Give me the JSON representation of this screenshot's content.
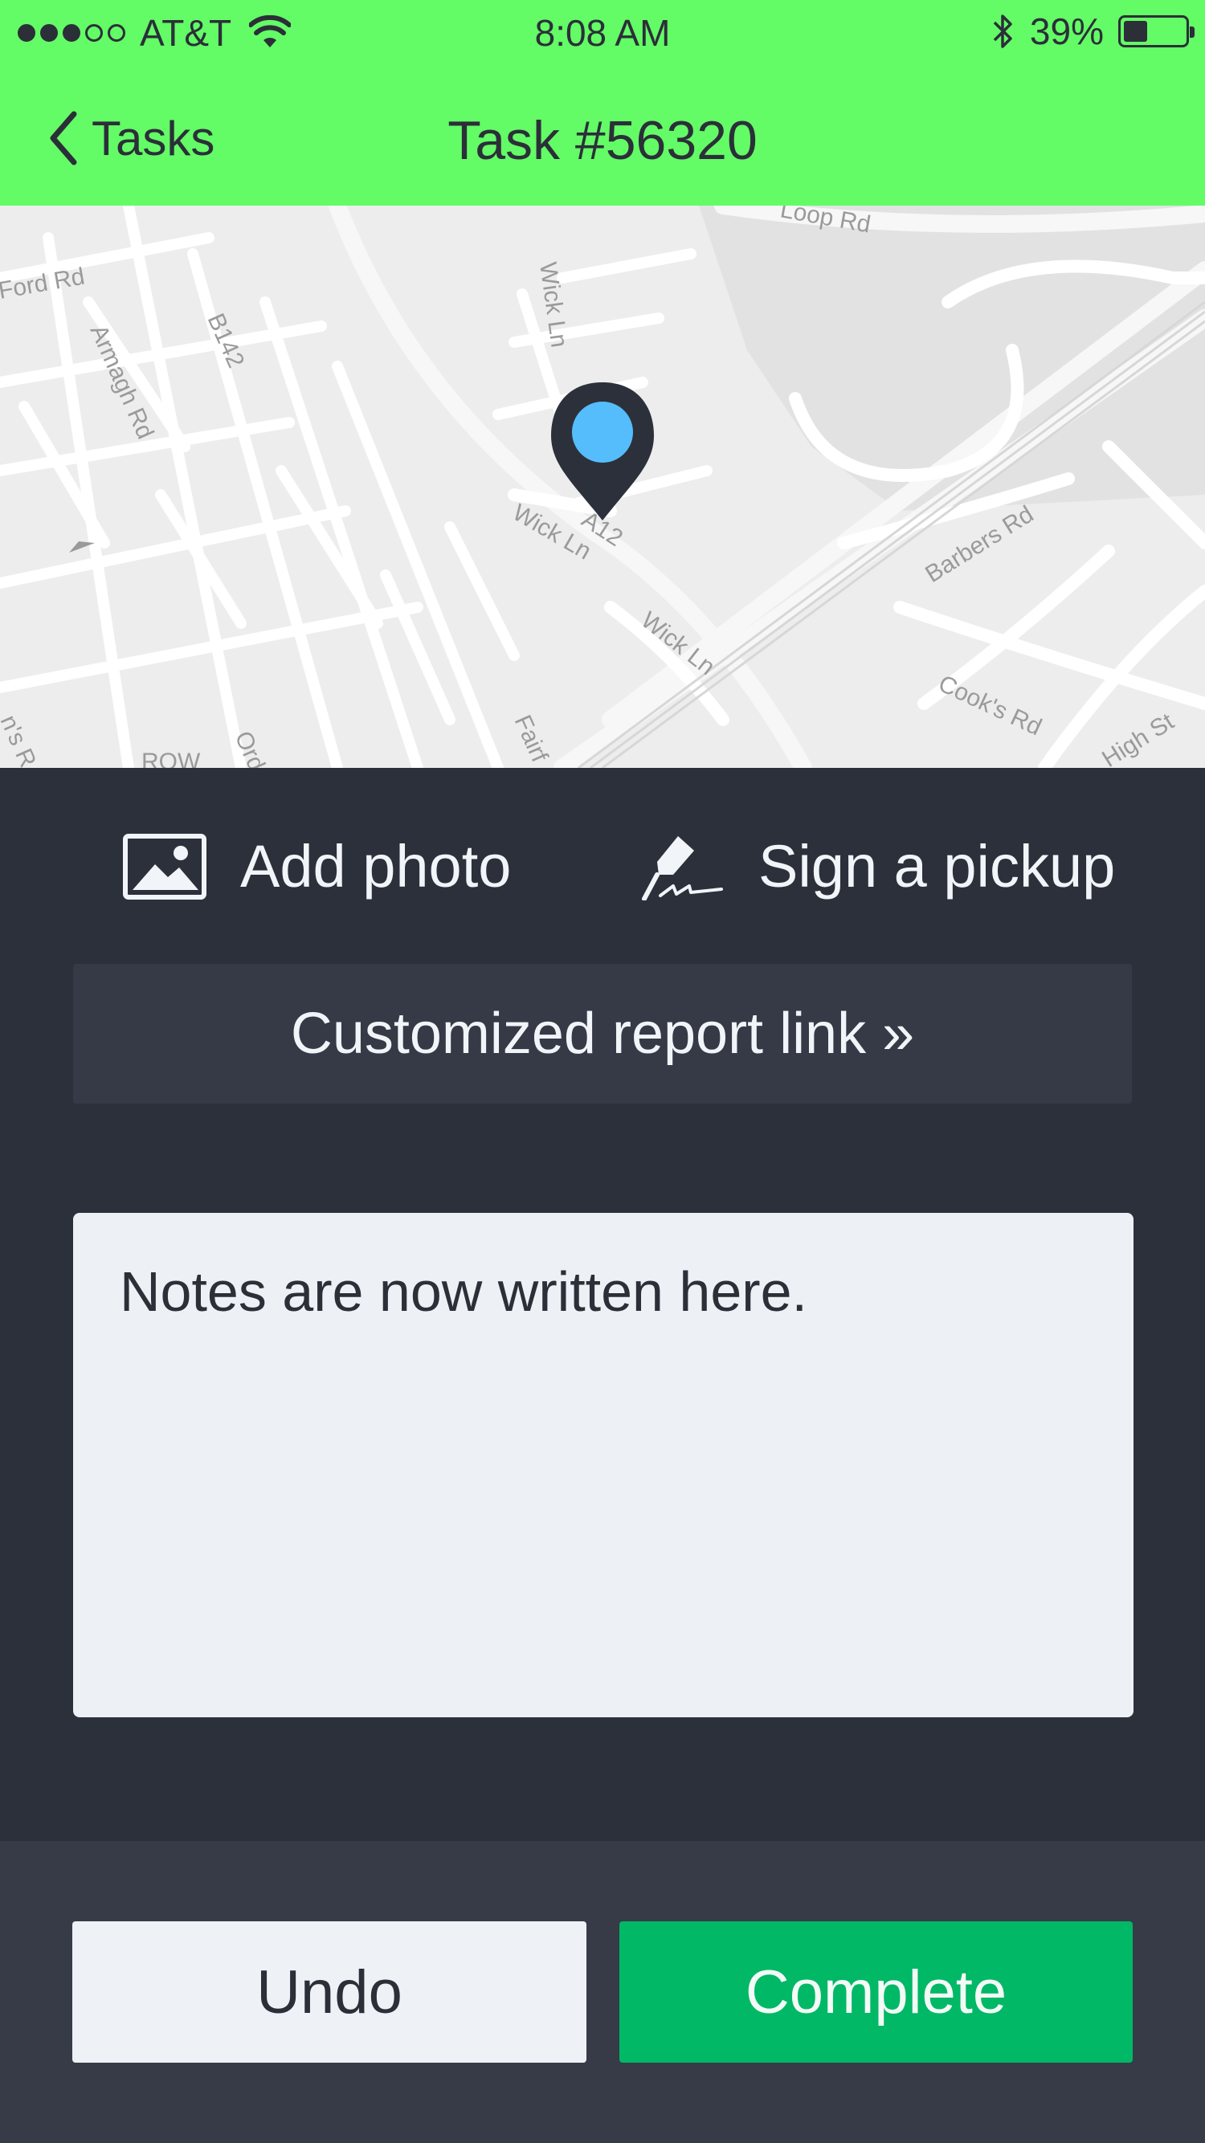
{
  "status_bar": {
    "carrier": "AT&T",
    "time": "8:08 AM",
    "battery_percent": "39%",
    "battery_level": 0.39,
    "signal_filled": 3,
    "signal_total": 5
  },
  "nav": {
    "back_label": "Tasks",
    "title": "Task #56320"
  },
  "map": {
    "labels": [
      "Ford Rd",
      "Armagh Rd",
      "B142",
      "Wick Ln",
      "Loop Rd",
      "A12",
      "Wick Ln",
      "Wick Ln",
      "Barbers Rd",
      "Cook's Rd",
      "High St",
      "Fairf",
      "Ord",
      "ROW",
      "n's R"
    ],
    "marker_icon": "map-pin-icon",
    "marker_color": "#55bdfb"
  },
  "actions": {
    "add_photo": "Add photo",
    "add_photo_icon": "image-icon",
    "sign_pickup": "Sign a pickup",
    "sign_pickup_icon": "pen-icon"
  },
  "report_link": "Customized report link »",
  "notes": {
    "value": "Notes are now written here."
  },
  "footer": {
    "undo": "Undo",
    "complete": "Complete"
  },
  "colors": {
    "nav_bg": "#63fb66",
    "body_bg": "#2c303b",
    "complete_bg": "#00b866",
    "undo_bg": "#eef1f6"
  }
}
